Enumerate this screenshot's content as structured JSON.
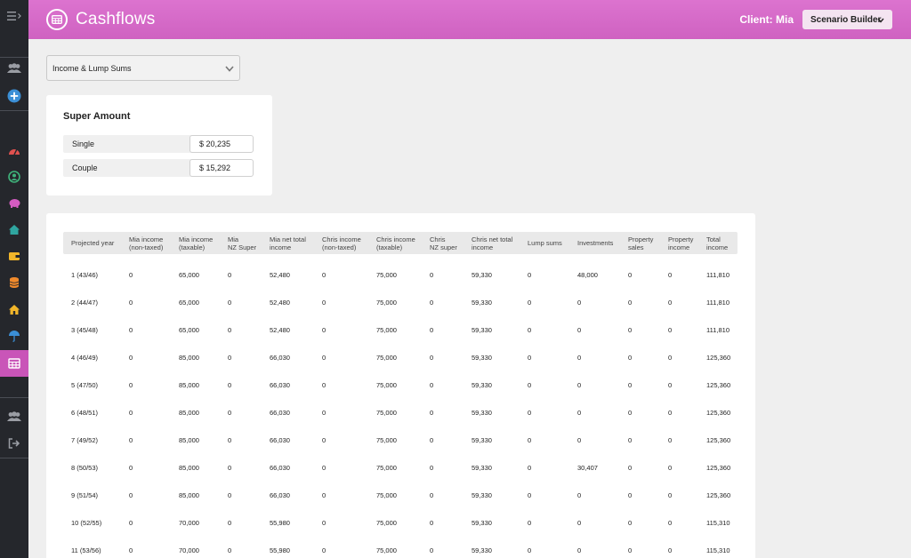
{
  "header": {
    "title": "Cashflows",
    "client_label": "Client: Mia",
    "scenario_button": "Scenario Builder"
  },
  "sidebar": {
    "items": [
      {
        "icon": "menu-expand-icon"
      },
      {
        "icon": "users-icon"
      },
      {
        "icon": "add-icon"
      },
      {
        "icon": "dashboard-icon"
      },
      {
        "icon": "user-circle-icon"
      },
      {
        "icon": "piggy-bank-icon"
      },
      {
        "icon": "home-icon"
      },
      {
        "icon": "wallet-icon"
      },
      {
        "icon": "coins-icon"
      },
      {
        "icon": "house-icon"
      },
      {
        "icon": "umbrella-icon"
      },
      {
        "icon": "table-icon",
        "active": true
      },
      {
        "icon": "team-icon"
      },
      {
        "icon": "logout-icon"
      }
    ]
  },
  "select": {
    "value": "Income & Lump Sums"
  },
  "super_amount": {
    "title": "Super Amount",
    "rows": [
      {
        "label": "Single",
        "value": "$ 20,235"
      },
      {
        "label": "Couple",
        "value": "$ 15,292"
      }
    ]
  },
  "table": {
    "headers": [
      "Projected year",
      "Mia income (non-taxed)",
      "Mia income (taxable)",
      "Mia NZ Super",
      "Mia net total income",
      "Chris income (non-taxed)",
      "Chris income (taxable)",
      "Chris NZ super",
      "Chris net total income",
      "Lump sums",
      "Investments",
      "Property sales",
      "Property income",
      "Total income"
    ],
    "header_lines": [
      [
        "Projected year"
      ],
      [
        "Mia income",
        "(non-taxed)"
      ],
      [
        "Mia income",
        "(taxable)"
      ],
      [
        "Mia",
        "NZ Super"
      ],
      [
        "Mia net total",
        "income"
      ],
      [
        "Chris income",
        "(non-taxed)"
      ],
      [
        "Chris income",
        "(taxable)"
      ],
      [
        "Chris",
        "NZ super"
      ],
      [
        "Chris net total",
        "income"
      ],
      [
        "Lump sums"
      ],
      [
        "Investments"
      ],
      [
        "Property",
        "sales"
      ],
      [
        "Property",
        "income"
      ],
      [
        "Total",
        "income"
      ]
    ],
    "rows": [
      [
        "1 (43/46)",
        "0",
        "65,000",
        "0",
        "52,480",
        "0",
        "75,000",
        "0",
        "59,330",
        "0",
        "48,000",
        "0",
        "0",
        "111,810"
      ],
      [
        "2 (44/47)",
        "0",
        "65,000",
        "0",
        "52,480",
        "0",
        "75,000",
        "0",
        "59,330",
        "0",
        "0",
        "0",
        "0",
        "111,810"
      ],
      [
        "3 (45/48)",
        "0",
        "65,000",
        "0",
        "52,480",
        "0",
        "75,000",
        "0",
        "59,330",
        "0",
        "0",
        "0",
        "0",
        "111,810"
      ],
      [
        "4 (46/49)",
        "0",
        "85,000",
        "0",
        "66,030",
        "0",
        "75,000",
        "0",
        "59,330",
        "0",
        "0",
        "0",
        "0",
        "125,360"
      ],
      [
        "5 (47/50)",
        "0",
        "85,000",
        "0",
        "66,030",
        "0",
        "75,000",
        "0",
        "59,330",
        "0",
        "0",
        "0",
        "0",
        "125,360"
      ],
      [
        "6 (48/51)",
        "0",
        "85,000",
        "0",
        "66,030",
        "0",
        "75,000",
        "0",
        "59,330",
        "0",
        "0",
        "0",
        "0",
        "125,360"
      ],
      [
        "7 (49/52)",
        "0",
        "85,000",
        "0",
        "66,030",
        "0",
        "75,000",
        "0",
        "59,330",
        "0",
        "0",
        "0",
        "0",
        "125,360"
      ],
      [
        "8 (50/53)",
        "0",
        "85,000",
        "0",
        "66,030",
        "0",
        "75,000",
        "0",
        "59,330",
        "0",
        "30,407",
        "0",
        "0",
        "125,360"
      ],
      [
        "9 (51/54)",
        "0",
        "85,000",
        "0",
        "66,030",
        "0",
        "75,000",
        "0",
        "59,330",
        "0",
        "0",
        "0",
        "0",
        "125,360"
      ],
      [
        "10 (52/55)",
        "0",
        "70,000",
        "0",
        "55,980",
        "0",
        "75,000",
        "0",
        "59,330",
        "0",
        "0",
        "0",
        "0",
        "115,310"
      ],
      [
        "11 (53/56)",
        "0",
        "70,000",
        "0",
        "55,980",
        "0",
        "75,000",
        "0",
        "59,330",
        "0",
        "0",
        "0",
        "0",
        "115,310"
      ]
    ]
  },
  "colors": {
    "header_accent": "#d46ac7",
    "sidebar_bg": "#25272c",
    "sidebar_active": "#c955b8",
    "icon_red": "#e0514f",
    "icon_green": "#3fb37b",
    "icon_pink": "#d55cc2",
    "icon_teal": "#2fa5a0",
    "icon_yellow": "#f2b62a",
    "icon_orange": "#f08a2c",
    "icon_blue": "#3b8fd6",
    "icon_gray": "#9a9da4"
  }
}
